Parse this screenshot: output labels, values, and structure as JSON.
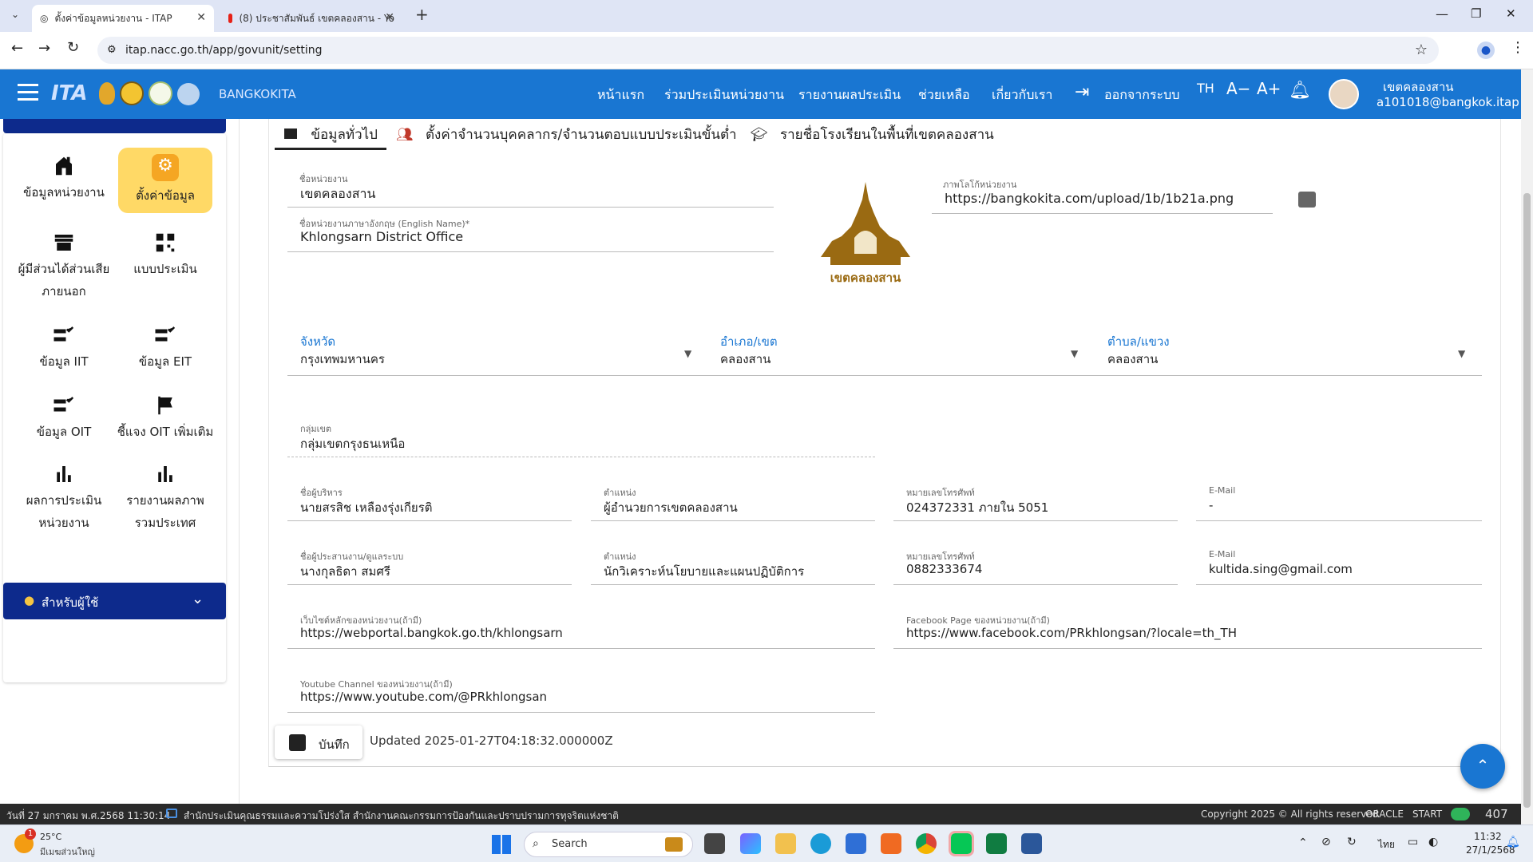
{
  "browser": {
    "tabs": [
      {
        "title": "ตั้งค่าข้อมูลหน่วยงาน - ITAP",
        "active": true
      },
      {
        "title": "(8) ประชาสัมพันธ์ เขตคลองสาน - Yo",
        "active": false
      }
    ],
    "url": "itap.nacc.go.th/app/govunit/setting"
  },
  "header": {
    "brand": "BANGKOKITA",
    "nav": [
      "หน้าแรก",
      "ร่วมประเมินหน่วยงาน",
      "รายงานผลประเมิน",
      "ช่วยเหลือ",
      "เกี่ยวกับเรา",
      "ออกจากระบบ"
    ],
    "lang": "TH",
    "font_minus": "A−",
    "font_plus": "A+",
    "user_name": "เขตคลองสาน",
    "user_email": "a101018@bangkok.itap"
  },
  "sidebar": {
    "items": [
      {
        "label": "ข้อมูลหน่วยงาน",
        "icon": "home-icon"
      },
      {
        "label": "ตั้งค่าข้อมูล",
        "icon": "gear-icon",
        "active": true
      },
      {
        "label": "ผู้มีส่วนได้ส่วนเสียภายนอก",
        "icon": "store-icon"
      },
      {
        "label": "แบบประเมิน",
        "icon": "qr-icon"
      },
      {
        "label": "ข้อมูล IIT",
        "icon": "checklist-icon"
      },
      {
        "label": "ข้อมูล EIT",
        "icon": "checklist-icon"
      },
      {
        "label": "ข้อมูล OIT",
        "icon": "checklist-icon"
      },
      {
        "label": "ชี้แจง OIT เพิ่มเติม",
        "icon": "flag-icon"
      },
      {
        "label": "ผลการประเมินหน่วยงาน",
        "icon": "bar-chart-icon"
      },
      {
        "label": "รายงานผลภาพรวมประเทศ",
        "icon": "bar-chart-icon"
      }
    ],
    "user_section": "สำหรับผู้ใช้"
  },
  "tabs": [
    "ข้อมูลทั่วไป",
    "ตั้งค่าจำนวนบุคคลากร/จำนวนตอบแบบประเมินขั้นต่ำ",
    "รายชื่อโรงเรียนในพื้นที่เขตคลองสาน"
  ],
  "form": {
    "unit_name_label": "ชื่อหน่วยงาน",
    "unit_name": "เขตคลองสาน",
    "english_name_label": "ชื่อหน่วยงานภาษาอังกฤษ (English Name)*",
    "english_name": "Khlongsarn District Office",
    "logo_text": "เขตคลองสาน",
    "logo_label": "ภาพโลโก้หน่วยงาน",
    "logo_url": "https://bangkokita.com/upload/1b/1b21a.png",
    "province_label": "จังหวัด",
    "province": "กรุงเทพมหานคร",
    "district_label": "อำเภอ/เขต",
    "district": "คลองสาน",
    "subdistrict_label": "ตำบล/แขวง",
    "subdistrict": "คลองสาน",
    "group_label": "กลุ่มเขต",
    "group": "กลุ่มเขตกรุงธนเหนือ",
    "exec_name_label": "ชื่อผู้บริหาร",
    "exec_name": "นายสรสิช เหลืองรุ่งเกียรติ",
    "exec_pos_label": "ตำแหน่ง",
    "exec_pos": "ผู้อำนวยการเขตคลองสาน",
    "exec_phone_label": "หมายเลขโทรศัพท์",
    "exec_phone": "024372331 ภายใน 5051",
    "exec_email_label": "E-Mail",
    "exec_email": "-",
    "coord_name_label": "ชื่อผู้ประสานงาน/ดูแลระบบ",
    "coord_name": "นางกุลธิดา สมศรี",
    "coord_pos_label": "ตำแหน่ง",
    "coord_pos": "นักวิเคราะห์นโยบายและแผนปฏิบัติการ",
    "coord_phone_label": "หมายเลขโทรศัพท์",
    "coord_phone": "0882333674",
    "coord_email_label": "E-Mail",
    "coord_email": "kultida.sing@gmail.com",
    "website_label": "เว็บไซต์หลักของหน่วยงาน(ถ้ามี)",
    "website": "https://webportal.bangkok.go.th/khlongsarn",
    "facebook_label": "Facebook Page ของหน่วยงาน(ถ้ามี)",
    "facebook": "https://www.facebook.com/PRkhlongsan/?locale=th_TH",
    "youtube_label": "Youtube Channel ของหน่วยงาน(ถ้ามี)",
    "youtube": "https://www.youtube.com/@PRkhlongsan",
    "save_label": "บันทึก",
    "updated": "Updated 2025-01-27T04:18:32.000000Z"
  },
  "statusbar": {
    "left": "วันที่ 27 มกราคม พ.ศ.2568 11:30:14",
    "org": "สำนักประเมินคุณธรรมและความโปร่งใส สำนักงานคณะกรรมการป้องกันและปราบปรามการทุจริตแห่งชาติ",
    "copyright": "Copyright 2025 © All rights reserved",
    "oracle": "ORACLE",
    "start": "START",
    "count": "407"
  },
  "taskbar": {
    "weather_temp": "25°C",
    "weather_desc": "มีเมฆส่วนใหญ่",
    "weather_badge": "1",
    "search": "Search",
    "lang": "ไทย",
    "time": "11:32",
    "date": "27/1/2568"
  },
  "colors": {
    "primary": "#1976d2",
    "sidebar_active": "#ffd966",
    "user_section": "#0d2a8c"
  }
}
